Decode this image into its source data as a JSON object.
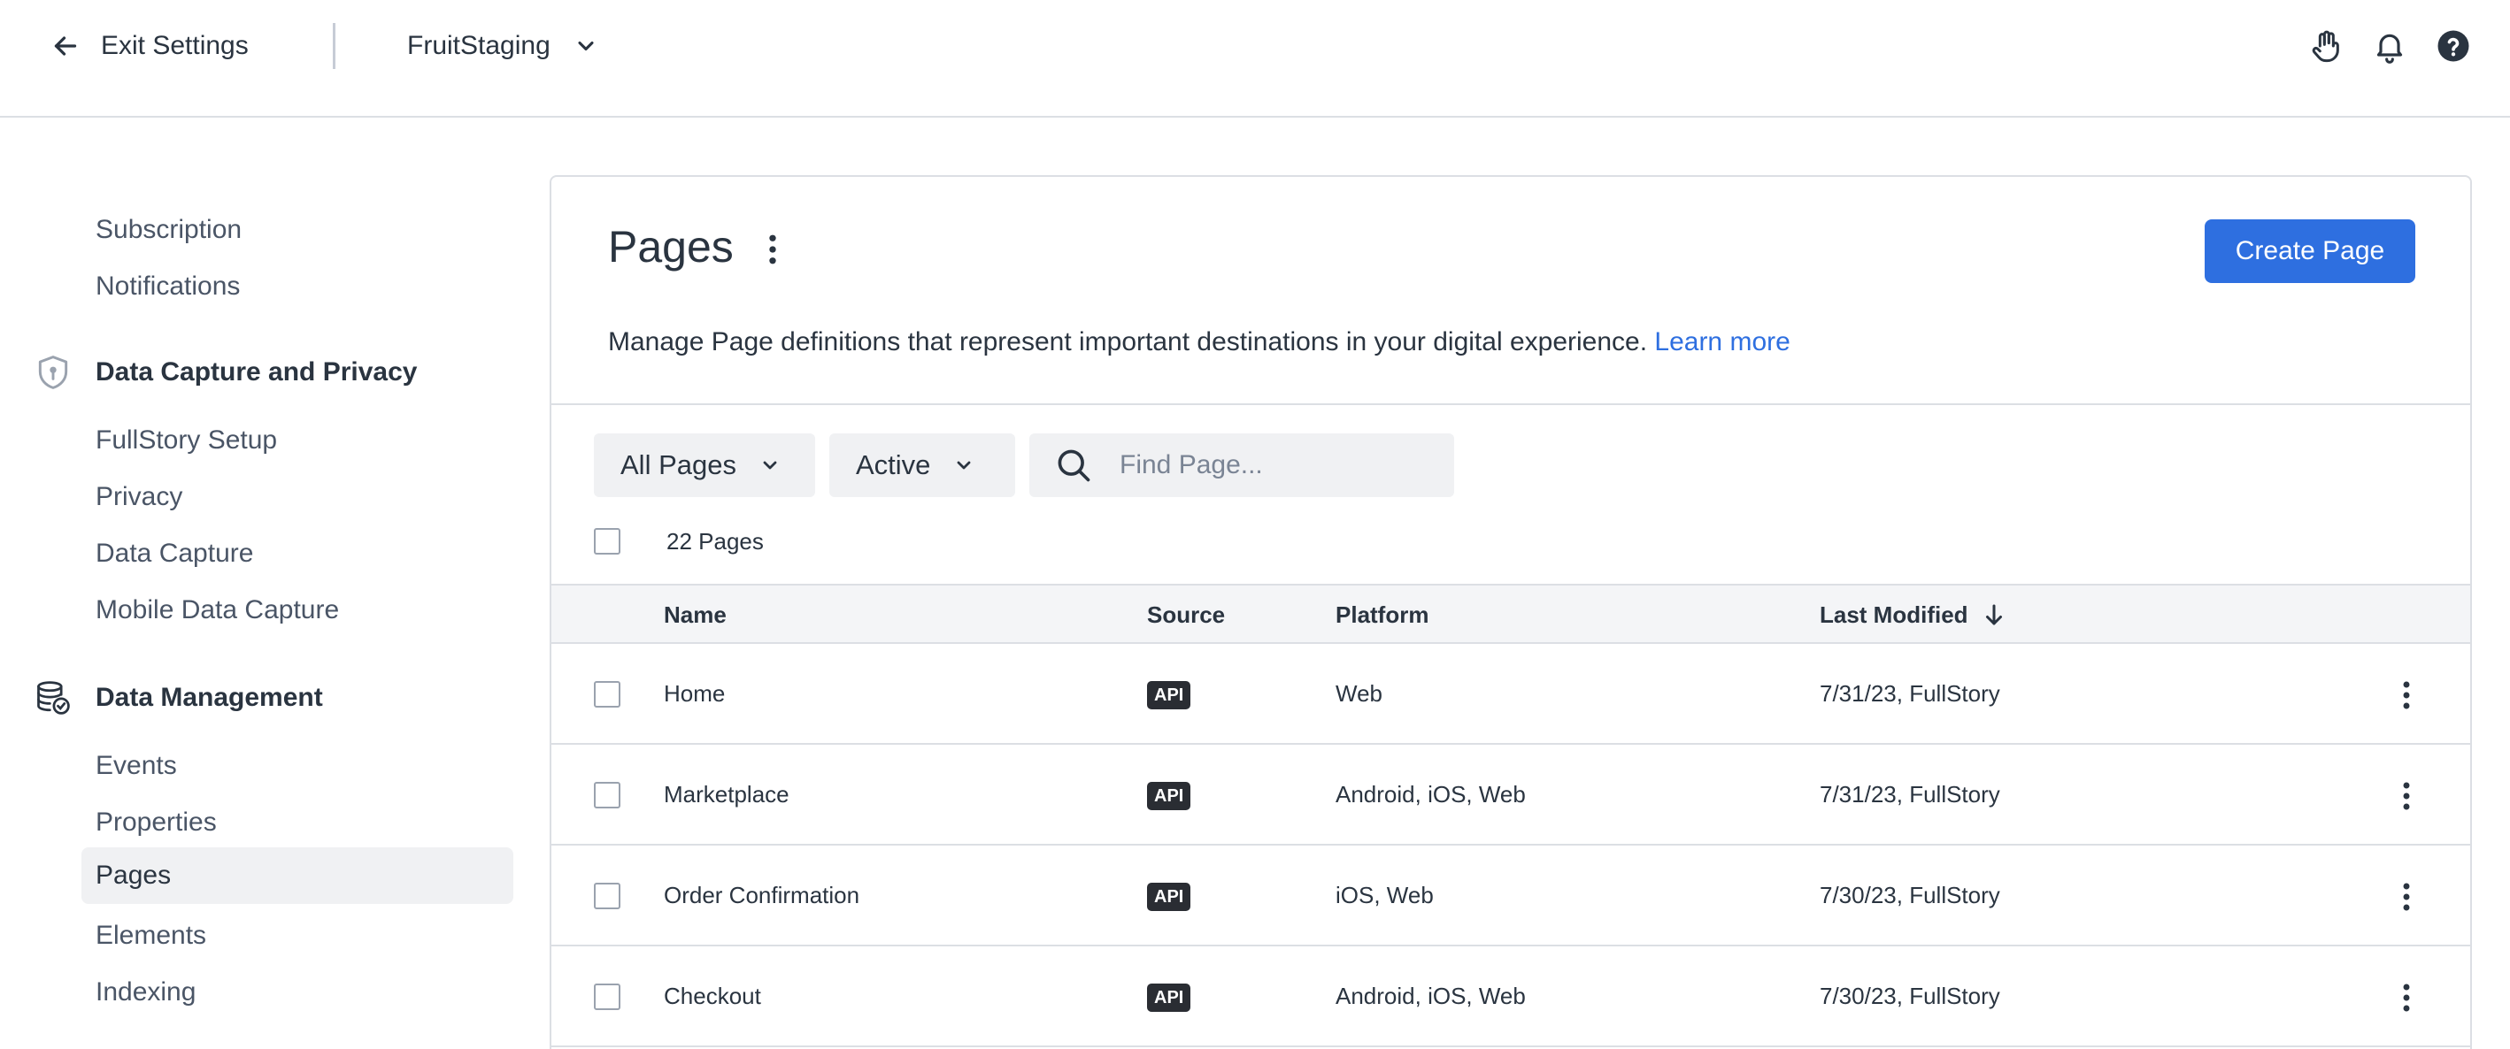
{
  "topbar": {
    "exit_label": "Exit Settings",
    "org_name": "FruitStaging",
    "icons": [
      "arrow-left-icon",
      "chevron-down-icon",
      "hand-icon",
      "bell-icon",
      "help-icon"
    ]
  },
  "sidebar": {
    "items_top": [
      {
        "label": "Subscription"
      },
      {
        "label": "Notifications"
      }
    ],
    "sections": [
      {
        "label": "Data Capture and Privacy",
        "icon": "shield-icon",
        "items": [
          {
            "label": "FullStory Setup"
          },
          {
            "label": "Privacy"
          },
          {
            "label": "Data Capture"
          },
          {
            "label": "Mobile Data Capture"
          }
        ]
      },
      {
        "label": "Data Management",
        "icon": "database-icon",
        "items": [
          {
            "label": "Events"
          },
          {
            "label": "Properties"
          },
          {
            "label": "Pages",
            "active": true
          },
          {
            "label": "Elements"
          },
          {
            "label": "Indexing"
          }
        ]
      }
    ]
  },
  "main": {
    "title": "Pages",
    "create_button": "Create Page",
    "description": "Manage Page definitions that represent important destinations in your digital experience.",
    "learn_more": "Learn more",
    "filters": {
      "scope": "All Pages",
      "status": "Active",
      "search_placeholder": "Find Page..."
    },
    "count_label": "22 Pages",
    "columns": {
      "name": "Name",
      "source": "Source",
      "platform": "Platform",
      "last_modified": "Last Modified"
    },
    "rows": [
      {
        "name": "Home",
        "source": "API",
        "platform": "Web",
        "last_modified": "7/31/23, FullStory"
      },
      {
        "name": "Marketplace",
        "source": "API",
        "platform": "Android, iOS, Web",
        "last_modified": "7/31/23, FullStory"
      },
      {
        "name": "Order Confirmation",
        "source": "API",
        "platform": "iOS, Web",
        "last_modified": "7/30/23, FullStory"
      },
      {
        "name": "Checkout",
        "source": "API",
        "platform": "Android, iOS, Web",
        "last_modified": "7/30/23, FullStory"
      }
    ]
  },
  "colors": {
    "accent": "#2e6fe0",
    "text": "#2a3440",
    "muted_text": "#4a5566",
    "border": "#dcdfe4",
    "badge_bg": "#2a2d33",
    "control_bg": "#f0f1f3"
  }
}
